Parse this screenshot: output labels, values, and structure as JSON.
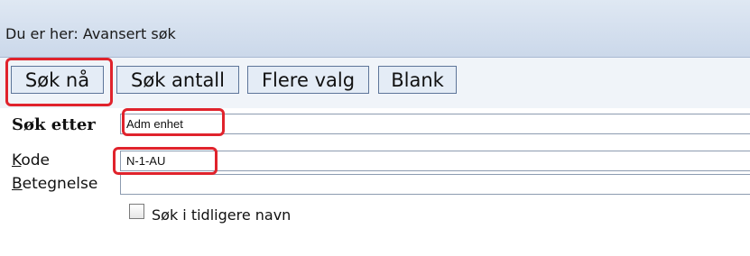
{
  "breadcrumb": {
    "text": "Du er her: Avansert søk"
  },
  "toolbar": {
    "search_now_label": "Søk nå",
    "search_count_label": "Søk antall",
    "more_options_label": "Flere valg",
    "blank_label": "Blank"
  },
  "form": {
    "search_for_label": "Søk etter",
    "search_for_value": "Adm enhet",
    "code_label_first": "K",
    "code_label_rest": "ode",
    "code_value": "N-1-AU",
    "name_label_first": "B",
    "name_label_rest": "etegnelse",
    "name_value": "",
    "previous_names_label": "Søk i tidligere navn",
    "previous_names_checked": false
  },
  "highlight_color": "#e0232c"
}
